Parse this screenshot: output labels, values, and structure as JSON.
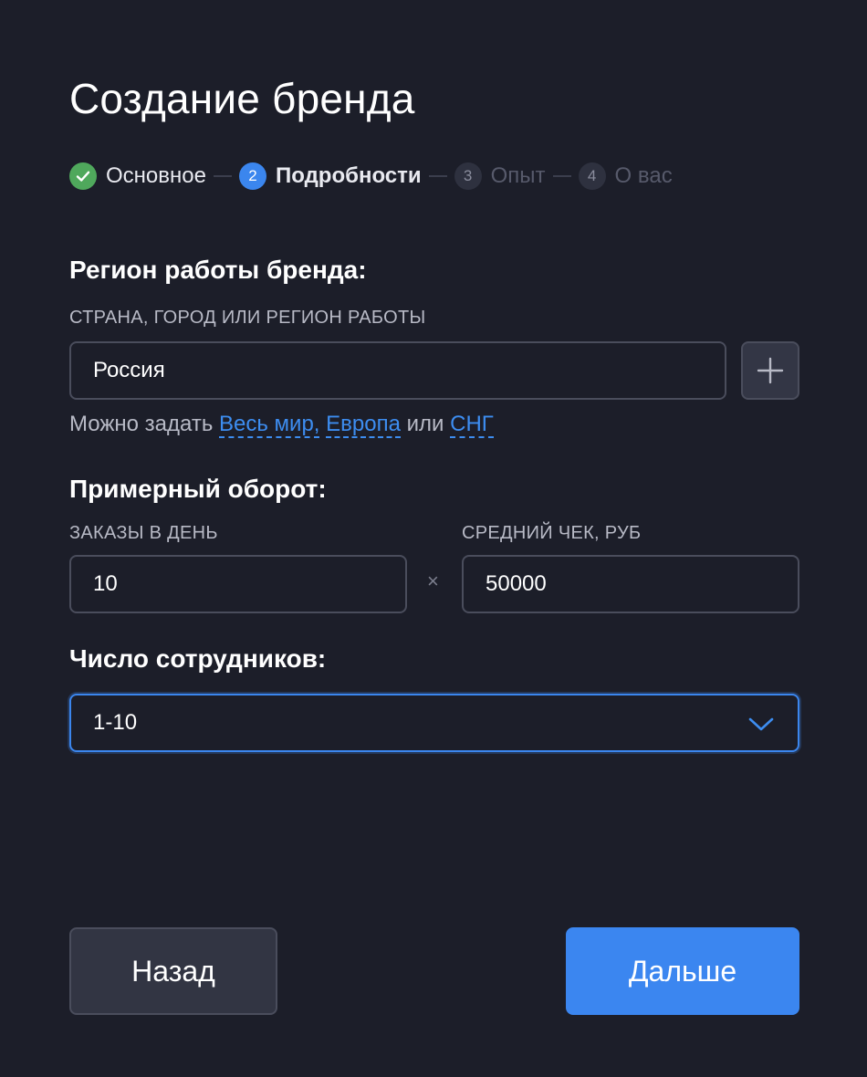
{
  "title": "Создание бренда",
  "steps": [
    {
      "number": "1",
      "label": "Основное",
      "state": "done",
      "icon": "check-icon"
    },
    {
      "number": "2",
      "label": "Подробности",
      "state": "active"
    },
    {
      "number": "3",
      "label": "Опыт",
      "state": "todo"
    },
    {
      "number": "4",
      "label": "О вас",
      "state": "todo"
    }
  ],
  "region": {
    "heading": "Регион работы бренда:",
    "caption": "СТРАНА, ГОРОД ИЛИ РЕГИОН РАБОТЫ",
    "value": "Россия",
    "add_icon": "plus-icon",
    "hint_prefix": "Можно задать",
    "hint_links": [
      "Весь мир,",
      "Европа",
      "СНГ"
    ],
    "hint_or": "или"
  },
  "turnover": {
    "heading": "Примерный оборот:",
    "orders_caption": "ЗАКАЗЫ В ДЕНЬ",
    "orders_value": "10",
    "multiply": "×",
    "check_caption": "СРЕДНИЙ ЧЕК, РУБ",
    "check_value": "50000"
  },
  "employees": {
    "heading": "Число сотрудников:",
    "selected": "1-10",
    "icon": "chevron-down-icon"
  },
  "buttons": {
    "back": "Назад",
    "next": "Дальше"
  },
  "colors": {
    "background": "#1c1e29",
    "accent": "#3b86f0",
    "success": "#4fa85c",
    "link": "#3d8df0"
  }
}
